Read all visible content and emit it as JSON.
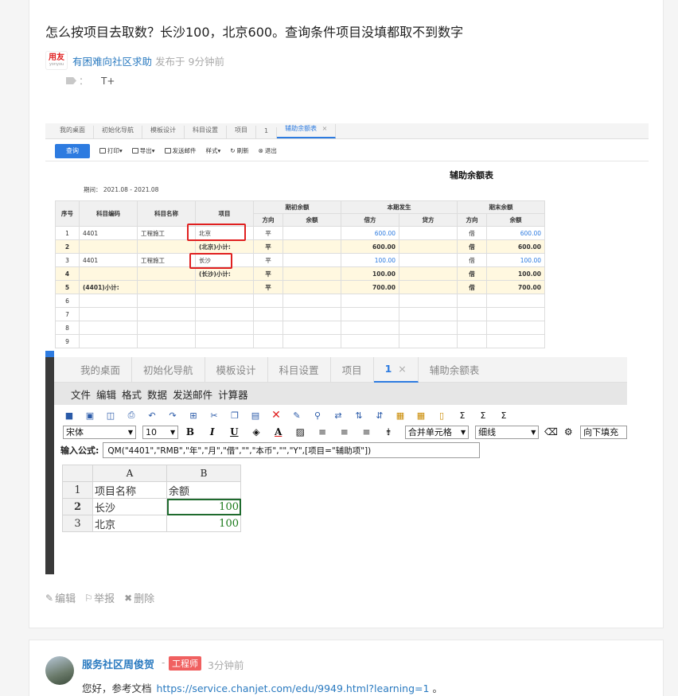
{
  "post": {
    "title": "怎么按项目去取数？长沙100，北京600。查询条件项目没填都取不到数字",
    "logo_text": "用友",
    "logo_sub": "yonyou",
    "author": "有困难向社区求助",
    "time": "发布于 9分钟前",
    "tag_colon": "：",
    "tag": "T+",
    "actions": {
      "edit": "编辑",
      "report": "举报",
      "delete": "删除"
    }
  },
  "shot1": {
    "tabs": [
      "我的桌面",
      "初始化导航",
      "模板设计",
      "科目设置",
      "项目",
      "1",
      "辅助余额表"
    ],
    "close": "×",
    "query_btn": "查询",
    "tools": [
      "打印",
      "导出",
      "发送邮件",
      "样式",
      "刷新",
      "退出"
    ],
    "report_title": "辅助余额表",
    "period": "期间：  2021.08 - 2021.08",
    "head1": [
      "序号",
      "科目编码",
      "科目名称",
      "项目",
      "期初余额",
      "本期发生",
      "期末余额"
    ],
    "head2": [
      "方向",
      "余额",
      "借方",
      "贷方",
      "方向",
      "余额"
    ],
    "rows": [
      {
        "no": "1",
        "code": "4401",
        "name": "工程施工",
        "item": "北京",
        "d1": "平",
        "b1": "",
        "debit": "600.00",
        "credit": "",
        "d2": "借",
        "b2": "600.00",
        "sub": false
      },
      {
        "no": "2",
        "code": "",
        "name": "",
        "item": "(北京)小计:",
        "d1": "平",
        "b1": "",
        "debit": "600.00",
        "credit": "",
        "d2": "借",
        "b2": "600.00",
        "sub": true
      },
      {
        "no": "3",
        "code": "4401",
        "name": "工程施工",
        "item": "长沙",
        "d1": "平",
        "b1": "",
        "debit": "100.00",
        "credit": "",
        "d2": "借",
        "b2": "100.00",
        "sub": false
      },
      {
        "no": "4",
        "code": "",
        "name": "",
        "item": "(长沙)小计:",
        "d1": "平",
        "b1": "",
        "debit": "100.00",
        "credit": "",
        "d2": "借",
        "b2": "100.00",
        "sub": true
      },
      {
        "no": "5",
        "code": "(4401)小计:",
        "name": "",
        "item": "",
        "d1": "平",
        "b1": "",
        "debit": "700.00",
        "credit": "",
        "d2": "借",
        "b2": "700.00",
        "sub": true
      },
      {
        "no": "6",
        "code": "",
        "name": "",
        "item": "",
        "d1": "",
        "b1": "",
        "debit": "",
        "credit": "",
        "d2": "",
        "b2": "",
        "sub": false
      },
      {
        "no": "7",
        "code": "",
        "name": "",
        "item": "",
        "d1": "",
        "b1": "",
        "debit": "",
        "credit": "",
        "d2": "",
        "b2": "",
        "sub": false
      },
      {
        "no": "8",
        "code": "",
        "name": "",
        "item": "",
        "d1": "",
        "b1": "",
        "debit": "",
        "credit": "",
        "d2": "",
        "b2": "",
        "sub": false
      },
      {
        "no": "9",
        "code": "",
        "name": "",
        "item": "",
        "d1": "",
        "b1": "",
        "debit": "",
        "credit": "",
        "d2": "",
        "b2": "",
        "sub": false
      }
    ]
  },
  "shot2": {
    "tabs": [
      "我的桌面",
      "初始化导航",
      "模板设计",
      "科目设置",
      "项目",
      "1",
      "辅助余额表"
    ],
    "close": "×",
    "menu": [
      "文件",
      "编辑",
      "格式",
      "数据",
      "发送邮件",
      "计算器"
    ],
    "font": "宋体",
    "size": "10",
    "merge": "合并单元格",
    "border": "细线",
    "fill_down": "向下填充",
    "formula_label": "输入公式:",
    "formula": "QM(\"4401\",\"RMB\",\"年\",\"月\",\"借\",\"\",\"本币\",\"\",\"Y\",[项目=\"辅助项\"])",
    "cols": [
      "A",
      "B"
    ],
    "rows": [
      {
        "n": "1",
        "a": "项目名称",
        "b": "余额"
      },
      {
        "n": "2",
        "a": "长沙",
        "b": "100"
      },
      {
        "n": "3",
        "a": "北京",
        "b": "100"
      }
    ]
  },
  "reply": {
    "author": "服务社区周俊贺",
    "dash": "-",
    "badge": "工程师",
    "time": "3分钟前",
    "text_prefix": "您好，参考文档",
    "link": "https://service.chanjet.com/edu/9949.html?learning=1",
    "text_suffix": "。"
  }
}
